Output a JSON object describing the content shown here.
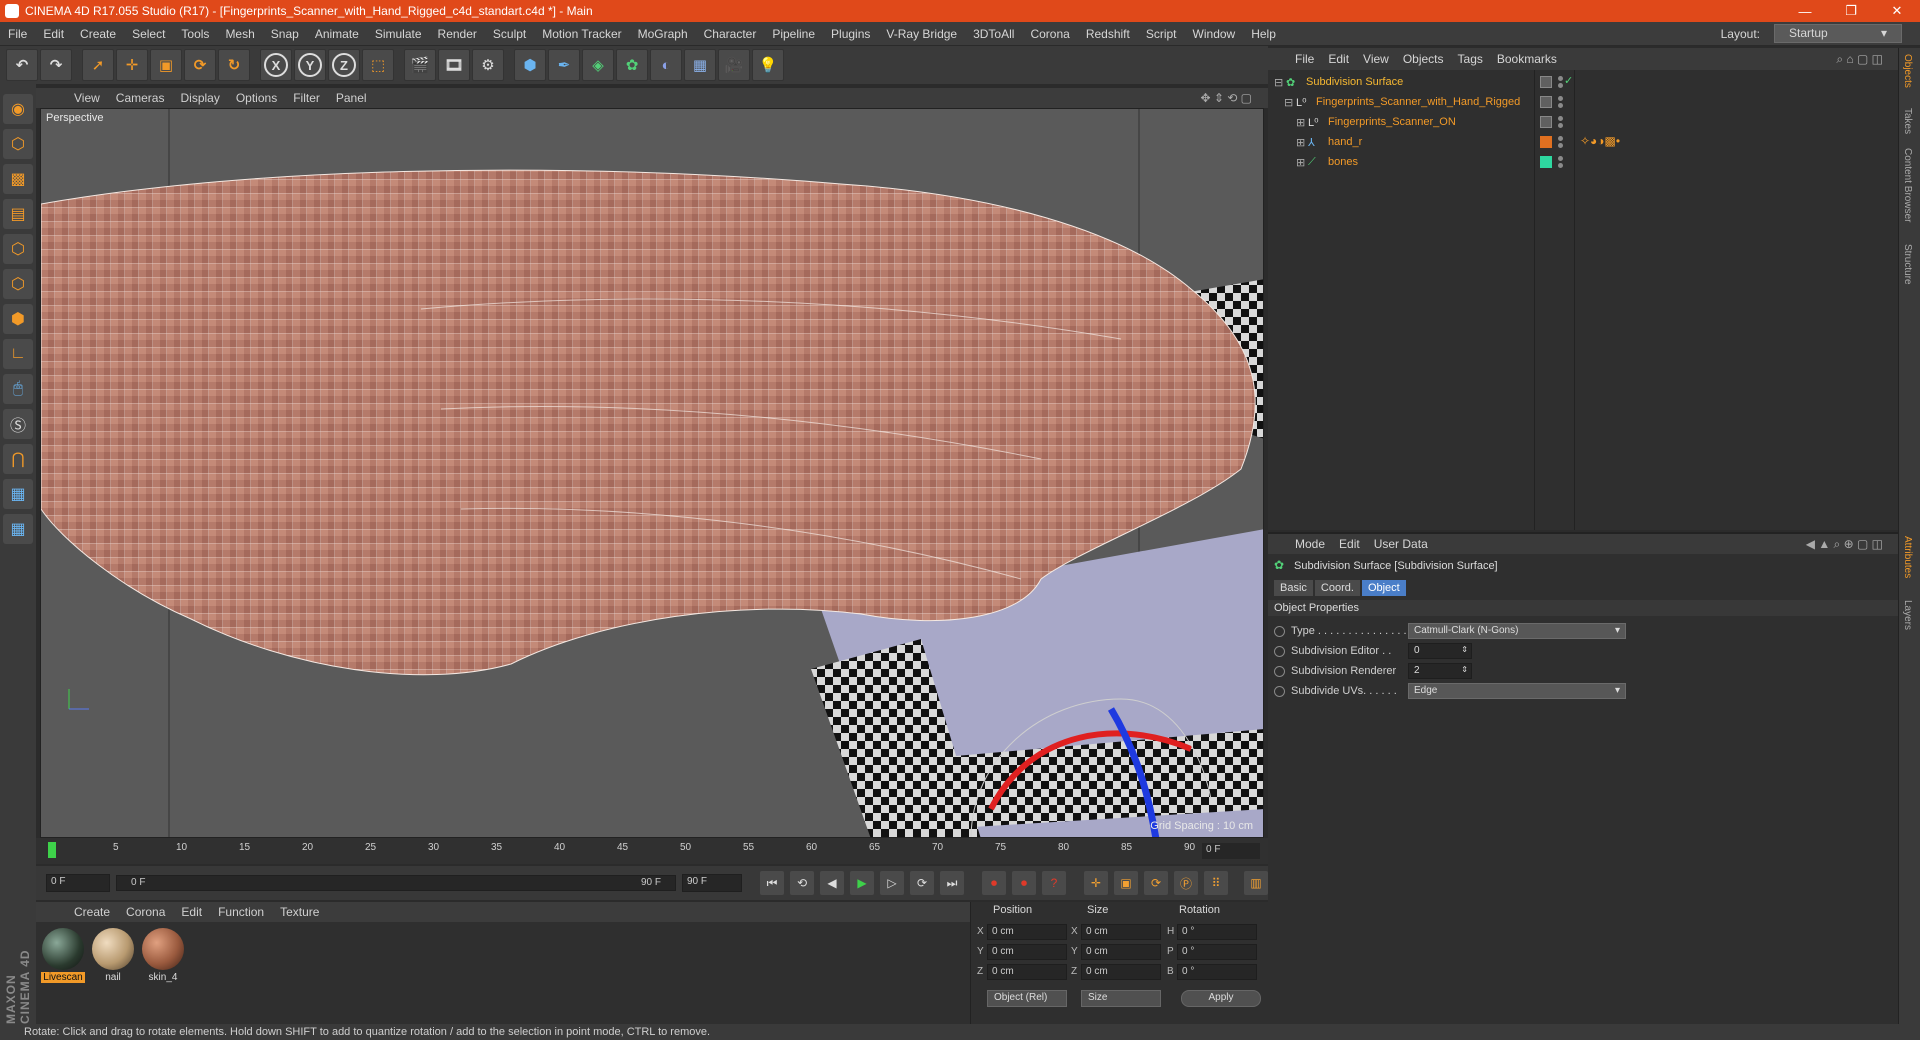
{
  "window": {
    "title": "CINEMA 4D R17.055 Studio (R17) - [Fingerprints_Scanner_with_Hand_Rigged_c4d_standart.c4d *] - Main",
    "controls": [
      "—",
      "❐",
      "✕"
    ]
  },
  "menubar": {
    "items": [
      "File",
      "Edit",
      "Create",
      "Select",
      "Tools",
      "Mesh",
      "Snap",
      "Animate",
      "Simulate",
      "Render",
      "Sculpt",
      "Motion Tracker",
      "MoGraph",
      "Character",
      "Pipeline",
      "Plugins",
      "V-Ray Bridge",
      "3DToAll",
      "Corona",
      "Redshift",
      "Script",
      "Window",
      "Help"
    ],
    "layout_label": "Layout:",
    "layout_value": "Startup"
  },
  "toolbar": {
    "axis_x": "X",
    "axis_y": "Y",
    "axis_z": "Z"
  },
  "viewport": {
    "menu": [
      "View",
      "Cameras",
      "Display",
      "Options",
      "Filter",
      "Panel"
    ],
    "camera_label": "Perspective",
    "grid_spacing": "Grid Spacing : 10 cm"
  },
  "timeline": {
    "ticks": [
      "0",
      "5",
      "10",
      "15",
      "20",
      "25",
      "30",
      "35",
      "40",
      "45",
      "50",
      "55",
      "60",
      "65",
      "70",
      "75",
      "80",
      "85",
      "90"
    ],
    "current_frame": "0 F",
    "start_field": "0 F",
    "range_start": "0 F",
    "range_end": "90 F",
    "end_field": "90 F"
  },
  "material_manager": {
    "menu": [
      "Create",
      "Corona",
      "Edit",
      "Function",
      "Texture"
    ],
    "materials": [
      {
        "name": "Livescan",
        "color": "#2a3a2e",
        "active": true
      },
      {
        "name": "nail",
        "color": "#b89a70",
        "active": false
      },
      {
        "name": "skin_4",
        "color": "#9a5a3e",
        "active": false
      }
    ]
  },
  "coordinates": {
    "headers": [
      "Position",
      "Size",
      "Rotation"
    ],
    "rows": [
      {
        "axis": "X",
        "pos": "0 cm",
        "size_axis": "X",
        "size": "0 cm",
        "rot_axis": "H",
        "rot": "0 °"
      },
      {
        "axis": "Y",
        "pos": "0 cm",
        "size_axis": "Y",
        "size": "0 cm",
        "rot_axis": "P",
        "rot": "0 °"
      },
      {
        "axis": "Z",
        "pos": "0 cm",
        "size_axis": "Z",
        "size": "0 cm",
        "rot_axis": "B",
        "rot": "0 °"
      }
    ],
    "mode": "Object (Rel)",
    "size_mode": "Size",
    "apply": "Apply"
  },
  "maxon": "MAXON CINEMA 4D",
  "status": "Rotate: Click and drag to rotate elements. Hold down SHIFT to add to quantize rotation / add to the selection in point mode, CTRL to remove.",
  "object_manager": {
    "menu": [
      "File",
      "Edit",
      "View",
      "Objects",
      "Tags",
      "Bookmarks"
    ],
    "objects": [
      {
        "name": "Subdivision Surface",
        "selected": true
      },
      {
        "name": "Fingerprints_Scanner_with_Hand_Rigged",
        "selected": false
      },
      {
        "name": "Fingerprints_Scanner_ON",
        "selected": false
      },
      {
        "name": "hand_r",
        "selected": false
      },
      {
        "name": "bones",
        "selected": false
      }
    ]
  },
  "attributes": {
    "menu": [
      "Mode",
      "Edit",
      "User Data"
    ],
    "object_title": "Subdivision Surface [Subdivision Surface]",
    "tabs": [
      {
        "label": "Basic",
        "active": false
      },
      {
        "label": "Coord.",
        "active": false
      },
      {
        "label": "Object",
        "active": true
      }
    ],
    "section": "Object Properties",
    "properties": [
      {
        "label": "Type . . . . . . . . . . . . . . .",
        "value": "Catmull-Clark (N-Gons)",
        "kind": "dropdown"
      },
      {
        "label": "Subdivision Editor . .",
        "value": "0",
        "kind": "number"
      },
      {
        "label": "Subdivision Renderer",
        "value": "2",
        "kind": "number"
      },
      {
        "label": "Subdivide UVs. . . . . .",
        "value": "Edge",
        "kind": "dropdown"
      }
    ]
  },
  "right_tabs": [
    "Objects",
    "Takes",
    "Content Browser",
    "Structure",
    "Attributes",
    "Layers"
  ]
}
